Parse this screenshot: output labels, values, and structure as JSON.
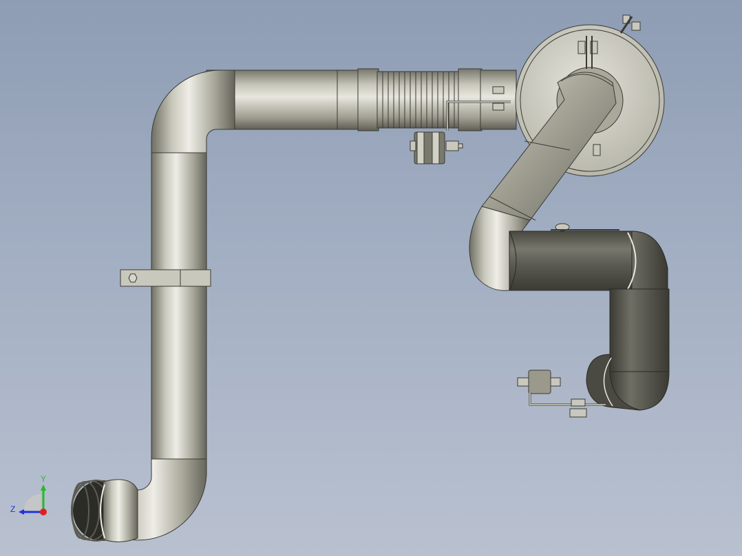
{
  "scene": {
    "description_name": "exhaust-pipe-assembly",
    "background_top": "#8e9db4",
    "background_bottom": "#b9c1d0",
    "pipe_color_light": "#d9d8ce",
    "pipe_color_mid": "#b4b3a6",
    "pipe_color_dark": "#6f6e63",
    "dark_pipe_color": "#5a5a52"
  },
  "triad": {
    "y_label": "Y",
    "z_label": "Z",
    "x_color": "#e02020",
    "y_color": "#22bb22",
    "z_color": "#2030e0"
  }
}
